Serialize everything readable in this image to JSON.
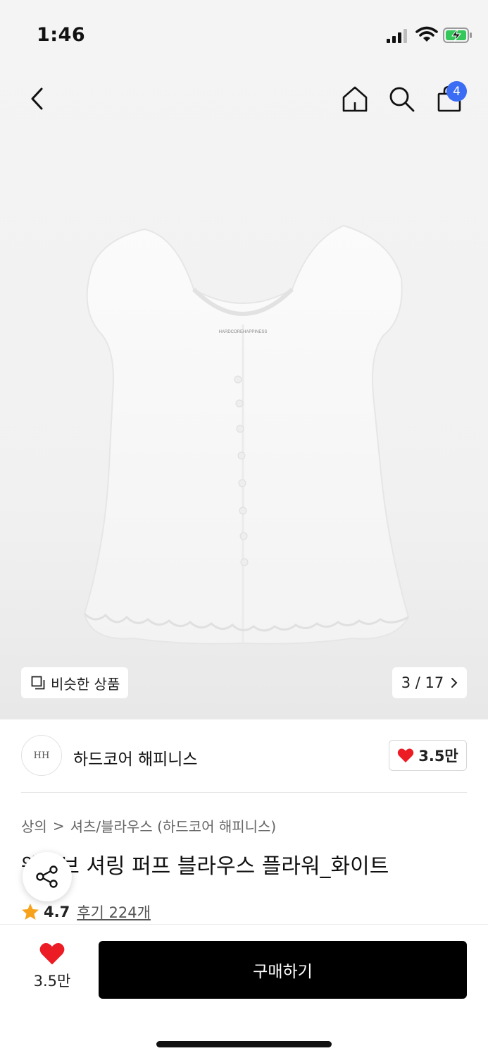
{
  "status_bar": {
    "time": "1:46"
  },
  "header": {
    "cart_count": "4"
  },
  "gallery": {
    "similar_label": "비슷한 상품",
    "page_current": "3",
    "page_separator": "/",
    "page_total": "17",
    "tag_text": "HARDCOREHAPPINESS"
  },
  "brand": {
    "logo_text": "HH",
    "name": "하드코어 해피니스",
    "like_count": "3.5만"
  },
  "breadcrumb": {
    "level1": "상의",
    "separator": ">",
    "level2": "셔츠/블라우스 (하드코어 해피니스)"
  },
  "product": {
    "title": "웨이브 셔링 퍼프 블라우스 플라워_화이트",
    "rating": "4.7",
    "reviews": "후기 224개"
  },
  "bottom_bar": {
    "wish_count": "3.5만",
    "buy_label": "구매하기"
  },
  "colors": {
    "accent_red": "#ec1c24",
    "badge_blue": "#3a6cf4",
    "star": "#f7a21b",
    "buy_bg": "#000000"
  },
  "icons": [
    "back-icon",
    "home-icon",
    "search-icon",
    "bag-icon",
    "similar-icon",
    "chevron-right-icon",
    "heart-icon",
    "share-icon",
    "star-icon"
  ]
}
